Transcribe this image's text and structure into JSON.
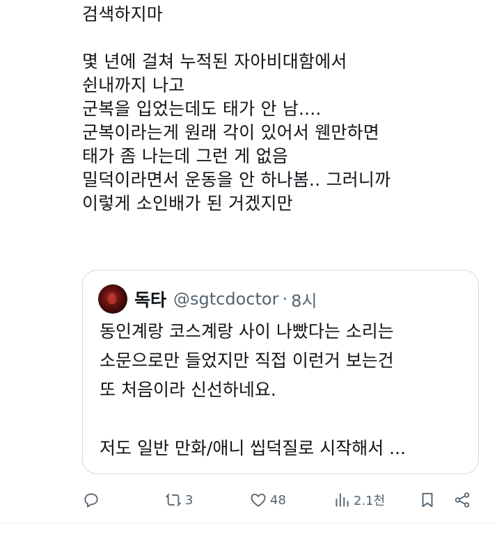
{
  "tweet": {
    "lines": [
      "검색하지마",
      "",
      "몇 년에 걸쳐 누적된 자아비대함에서",
      "쉰내까지 나고",
      "군복을 입었는데도 태가 안 남....",
      "군복이라는게 원래 각이 있어서 웬만하면",
      "태가 좀 나는데 그런 게 없음",
      "밀덕이라면서 운동을 안 하나봄.. 그러니까",
      "이렇게 소인배가 된 거겠지만"
    ]
  },
  "quote": {
    "name": "독타",
    "handle": "@sgtcdoctor",
    "separator": "·",
    "time": "8시",
    "lines": [
      "동인계랑 코스계랑 사이 나빴다는 소리는",
      "소문으로만 들었지만 직접 이런거 보는건",
      "또 처음이라 신선하네요.",
      "",
      "저도 일반 만화/애니 씹덕질로 시작해서 ..."
    ]
  },
  "actions": {
    "reply": {
      "icon": "reply-icon",
      "count": ""
    },
    "retweet": {
      "icon": "retweet-icon",
      "count": "3"
    },
    "like": {
      "icon": "heart-icon",
      "count": "48"
    },
    "views": {
      "icon": "views-icon",
      "count": "2.1천"
    },
    "bookmark": {
      "icon": "bookmark-icon"
    },
    "share": {
      "icon": "share-icon"
    }
  },
  "colors": {
    "text": "#0f1419",
    "secondary": "#536471",
    "border": "#cfd9de"
  }
}
